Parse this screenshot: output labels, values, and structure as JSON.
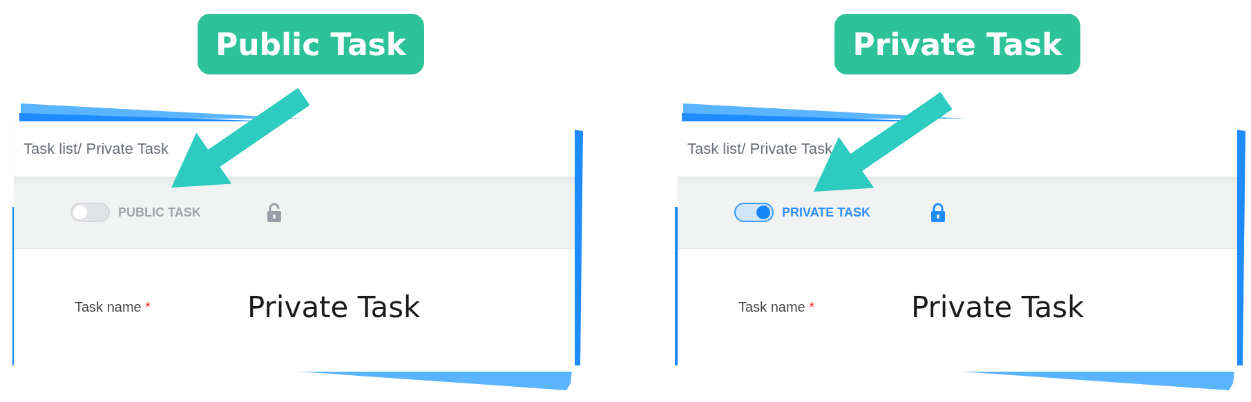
{
  "examples": [
    {
      "title": "Public Task",
      "breadcrumb": "Task list/ Private Task",
      "privacy_toggle": {
        "on": false,
        "label": "PUBLIC TASK"
      },
      "field": {
        "label": "Task name",
        "required_mark": "*",
        "value": "Private Task"
      }
    },
    {
      "title": "Private Task",
      "breadcrumb": "Task list/ Private Task",
      "privacy_toggle": {
        "on": true,
        "label": "PRIVATE TASK"
      },
      "field": {
        "label": "Task name",
        "required_mark": "*",
        "value": "Private Task"
      }
    }
  ]
}
